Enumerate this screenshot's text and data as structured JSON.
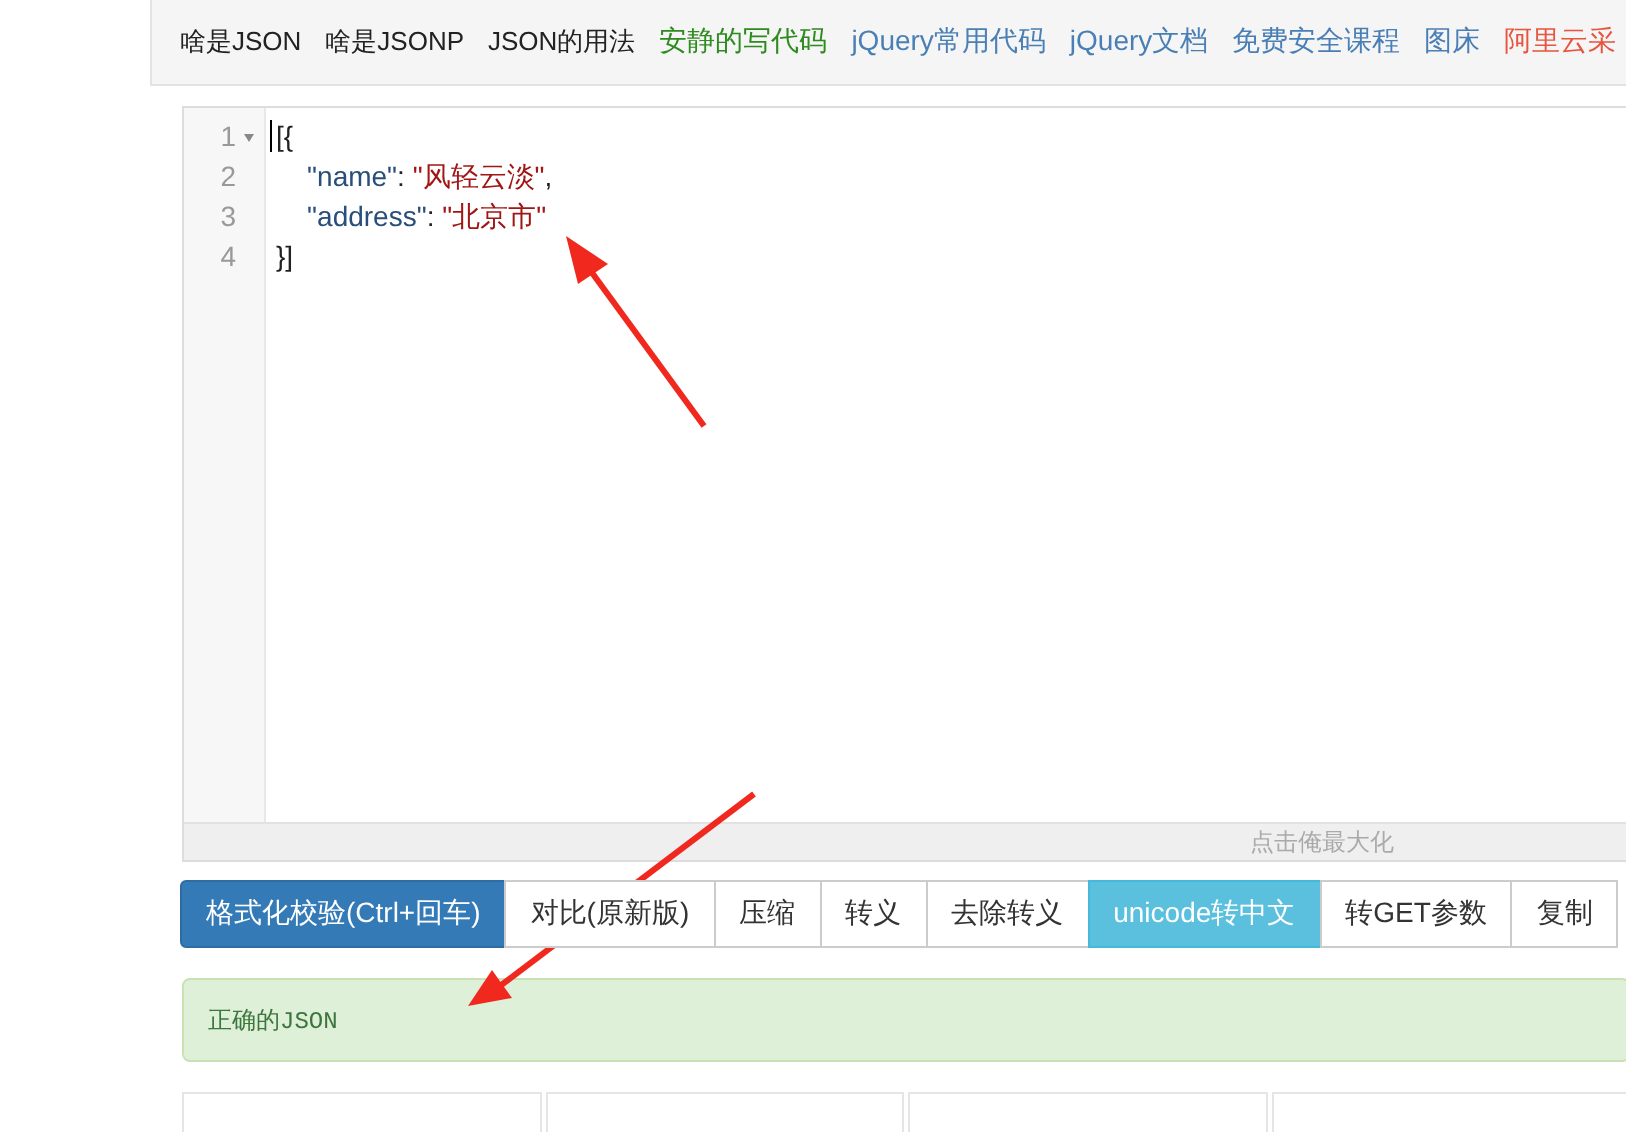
{
  "nav": [
    {
      "label": "啥是JSON",
      "color": "#222222"
    },
    {
      "label": "啥是JSONP",
      "color": "#222222"
    },
    {
      "label": "JSON的用法",
      "color": "#222222"
    },
    {
      "label": "安静的写代码",
      "color": "#2e8b1f"
    },
    {
      "label": "jQuery常用代码",
      "color": "#4a7fb5"
    },
    {
      "label": "jQuery文档",
      "color": "#4a7fb5"
    },
    {
      "label": "免费安全课程",
      "color": "#4a7fb5"
    },
    {
      "label": "图床",
      "color": "#4a7fb5"
    },
    {
      "label": "阿里云采",
      "color": "#e8553f"
    }
  ],
  "editor": {
    "lines": [
      {
        "number": "1",
        "foldable": true,
        "tokens": [
          {
            "text": "[{",
            "kind": "punct"
          }
        ]
      },
      {
        "number": "2",
        "foldable": false,
        "tokens": [
          {
            "text": "    \"name\"",
            "kind": "key"
          },
          {
            "text": ": ",
            "kind": "punct"
          },
          {
            "text": "\"风轻云淡\"",
            "kind": "string"
          },
          {
            "text": ",",
            "kind": "punct"
          }
        ]
      },
      {
        "number": "3",
        "foldable": false,
        "tokens": [
          {
            "text": "    \"address\"",
            "kind": "key"
          },
          {
            "text": ": ",
            "kind": "punct"
          },
          {
            "text": "\"北京市\"",
            "kind": "string"
          }
        ]
      },
      {
        "number": "4",
        "foldable": false,
        "tokens": [
          {
            "text": "}]",
            "kind": "punct"
          }
        ]
      }
    ],
    "maximize_hint": "点击俺最大化"
  },
  "buttons": [
    {
      "label": "格式化校验(Ctrl+回车)",
      "kind": "primary"
    },
    {
      "label": "对比(原新版)",
      "kind": "default"
    },
    {
      "label": "压缩",
      "kind": "default"
    },
    {
      "label": "转义",
      "kind": "default"
    },
    {
      "label": "去除转义",
      "kind": "default"
    },
    {
      "label": "unicode转中文",
      "kind": "info"
    },
    {
      "label": "转GET参数",
      "kind": "default"
    },
    {
      "label": "复制",
      "kind": "default"
    }
  ],
  "result": {
    "message": "正确的JSON"
  }
}
